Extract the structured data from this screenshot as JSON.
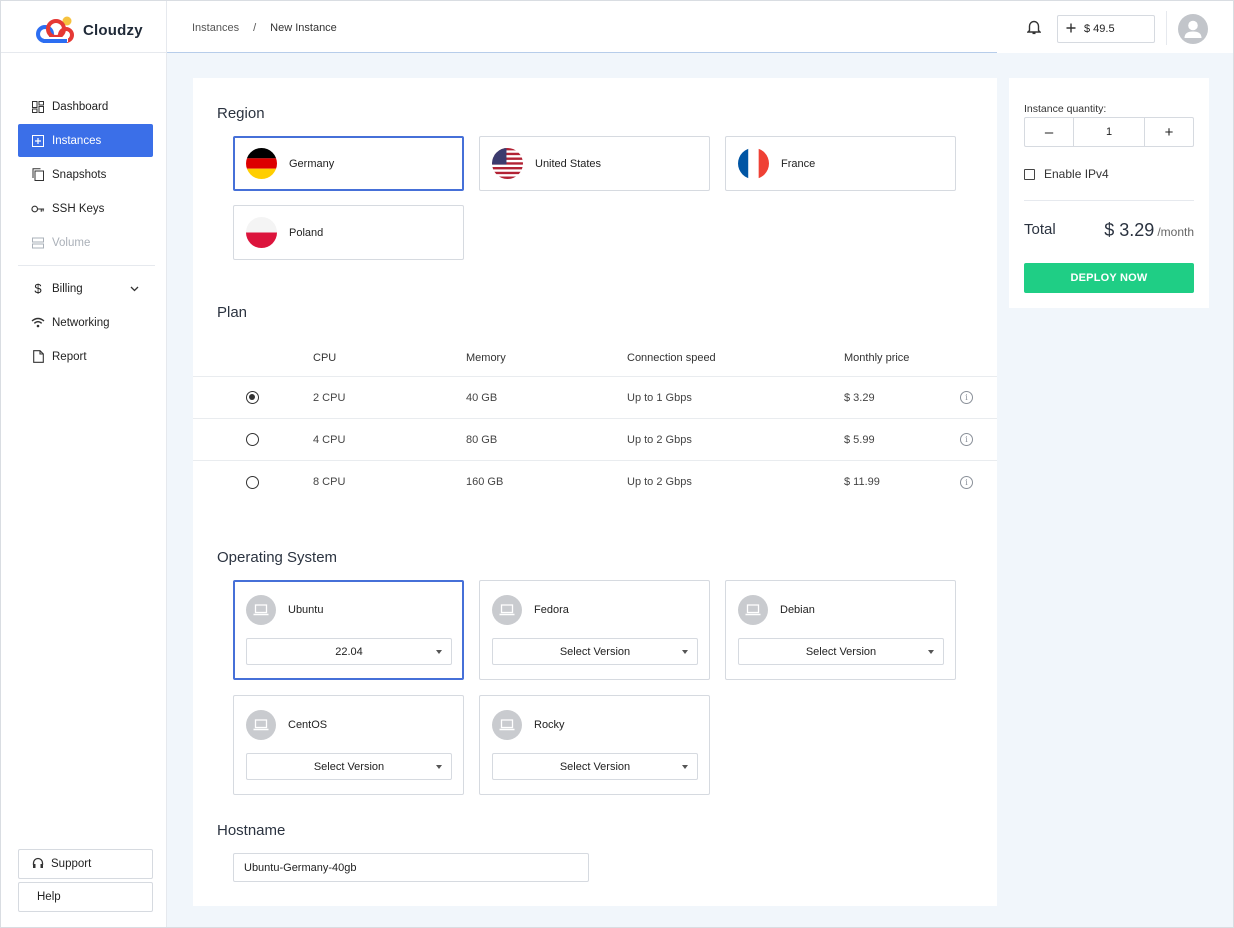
{
  "app": {
    "name": "Cloudzy"
  },
  "breadcrumb": {
    "parent": "Instances",
    "separator": "/",
    "current": "New Instance"
  },
  "header": {
    "balance": "$ 49.5",
    "add_icon": "plus-icon",
    "bell_icon": "bell-icon",
    "avatar_icon": "user-avatar-icon"
  },
  "sidebar": {
    "items": [
      {
        "label": "Dashboard",
        "icon": "dashboard-icon"
      },
      {
        "label": "Instances",
        "icon": "add-box-icon"
      },
      {
        "label": "Snapshots",
        "icon": "copy-icon"
      },
      {
        "label": "SSH Keys",
        "icon": "key-icon"
      },
      {
        "label": "Volume",
        "icon": "storage-icon"
      },
      {
        "label": "Billing",
        "icon": "dollar-icon"
      },
      {
        "label": "Networking",
        "icon": "wifi-icon"
      },
      {
        "label": "Report",
        "icon": "document-icon"
      }
    ],
    "support": "Support",
    "help": "Help"
  },
  "region": {
    "title": "Region",
    "options": [
      {
        "name": "Germany"
      },
      {
        "name": "United States"
      },
      {
        "name": "France"
      },
      {
        "name": "Poland"
      }
    ]
  },
  "plan": {
    "title": "Plan",
    "headers": {
      "cpu": "CPU",
      "memory": "Memory",
      "speed": "Connection speed",
      "price": "Monthly price"
    },
    "rows": [
      {
        "cpu": "2 CPU",
        "memory": "40 GB",
        "speed": "Up to 1 Gbps",
        "price": "$ 3.29",
        "selected": true
      },
      {
        "cpu": "4 CPU",
        "memory": "80 GB",
        "speed": "Up to 2 Gbps",
        "price": "$ 5.99",
        "selected": false
      },
      {
        "cpu": "8 CPU",
        "memory": "160 GB",
        "speed": "Up to 2 Gbps",
        "price": "$ 11.99",
        "selected": false
      }
    ]
  },
  "os": {
    "title": "Operating System",
    "options": [
      {
        "name": "Ubuntu",
        "version": "22.04"
      },
      {
        "name": "Fedora",
        "version": "Select Version"
      },
      {
        "name": "Debian",
        "version": "Select Version"
      },
      {
        "name": "CentOS",
        "version": "Select Version"
      },
      {
        "name": "Rocky",
        "version": "Select Version"
      }
    ]
  },
  "hostname": {
    "title": "Hostname",
    "value": "Ubuntu-Germany-40gb"
  },
  "summary": {
    "quantity_label": "Instance quantity:",
    "quantity": "1",
    "minus": "–",
    "plus": "+",
    "ipv4_label": "Enable IPv4",
    "total_label": "Total",
    "total_amount": "$ 3.29",
    "total_period": "/month",
    "deploy_label": "DEPLOY NOW"
  },
  "colors": {
    "accent": "#3b6fe8",
    "deploy": "#1fce85",
    "background": "#f1f6fb"
  }
}
